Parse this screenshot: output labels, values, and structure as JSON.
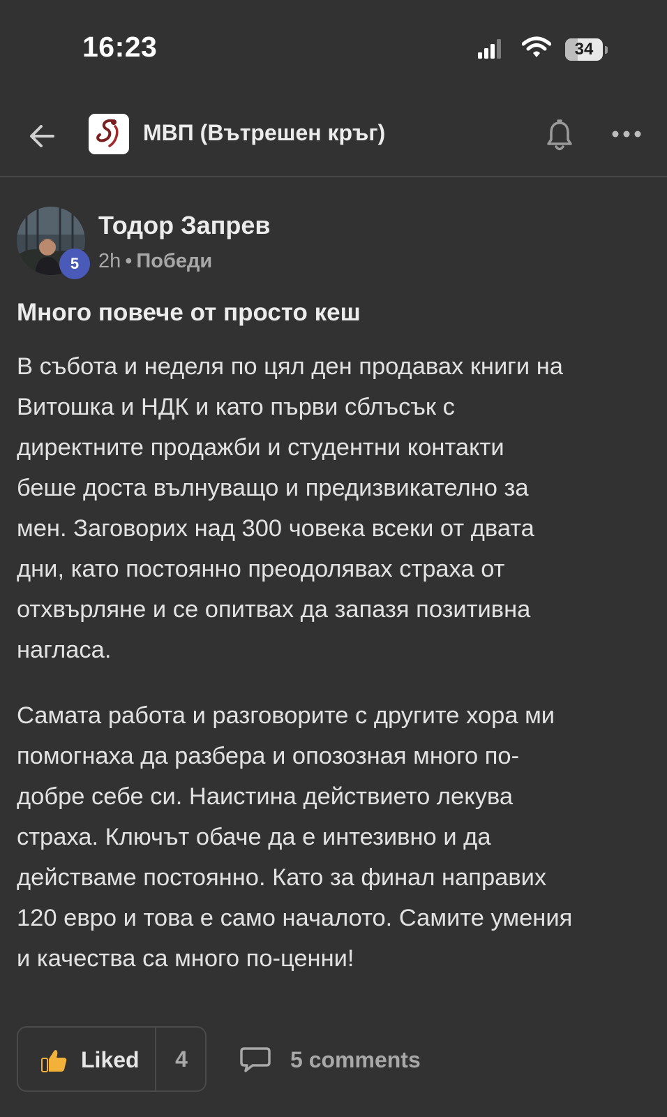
{
  "status_bar": {
    "time": "16:23",
    "battery": "34",
    "battery_level": 0.34
  },
  "header": {
    "group_title": "МВП (Вътрешен кръг)",
    "back_icon": "arrow-left-icon",
    "bell_icon": "bell-icon",
    "more_icon": "more-horizontal-icon"
  },
  "post": {
    "author": "Тодор Запрев",
    "level_badge": "5",
    "time_ago": "2h",
    "separator": "•",
    "category": "Победи",
    "title": "Много повече от просто кеш",
    "paragraphs": [
      "В събота и неделя по цял ден продавах книги на\nВитошка и НДК и като първи сблъсък с\nдиректните продажби и студентни контакти\nбеше доста вълнуващо и предизвикателно за\nмен. Заговорих над 300 човека всеки от двата\nдни, като постоянно преодолявах страха от\nотхвърляне и се опитвах да запазя позитивна\nнагласа.",
      "Самата работа и разговорите с другите хора ми\nпомогнаха да разбера и опозозная много по-\nдобре себе си. Наистина действието лекува\nстраха. Ключът обаче да е интезивно и да\nдействаме постоянно. Като за финал направих\n120 евро и това е само началото. Самите умения\nи качества са много по-ценни!"
    ]
  },
  "actions": {
    "like_label": "Liked",
    "like_count": "4",
    "comments_label": "5 comments",
    "like_icon": "thumbs-up-icon",
    "comment_icon": "comment-bubble-icon"
  },
  "colors": {
    "background": "#323232",
    "badge": "#4a5ab8",
    "like_icon": "#f2b23a"
  }
}
